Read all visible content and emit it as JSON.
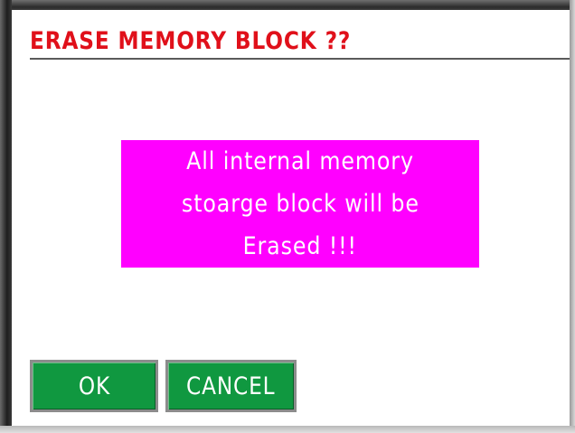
{
  "dialog": {
    "title": "ERASE MEMORY BLOCK ??",
    "message_lines": [
      "All internal memory",
      "stoarge block will be",
      "Erased  !!!"
    ]
  },
  "buttons": {
    "ok_label": "OK",
    "cancel_label": "CANCEL"
  },
  "colors": {
    "title": "#e0101a",
    "message_background": "#ff00ff",
    "message_text": "#ffffff",
    "button_background": "#109840",
    "button_text": "#ffffff"
  }
}
